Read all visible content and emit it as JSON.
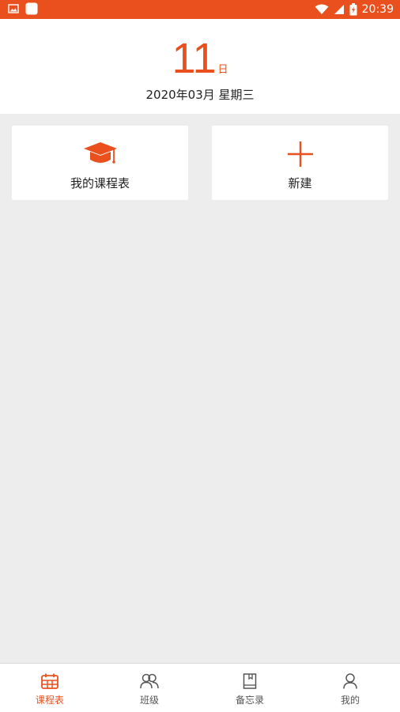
{
  "status_bar": {
    "time": "20:39"
  },
  "header": {
    "day_number": "11",
    "day_unit": "日",
    "date_line": "2020年03月 星期三"
  },
  "cards": {
    "my_schedule": {
      "label": "我的课程表",
      "icon": "graduation-cap-icon"
    },
    "new": {
      "label": "新建",
      "icon": "plus-icon"
    }
  },
  "bottom_nav": {
    "items": [
      {
        "label": "课程表",
        "icon": "calendar-icon",
        "active": true
      },
      {
        "label": "班级",
        "icon": "people-icon",
        "active": false
      },
      {
        "label": "备忘录",
        "icon": "memo-icon",
        "active": false
      },
      {
        "label": "我的",
        "icon": "person-icon",
        "active": false
      }
    ]
  },
  "colors": {
    "accent": "#ea501d",
    "background": "#ededed"
  }
}
